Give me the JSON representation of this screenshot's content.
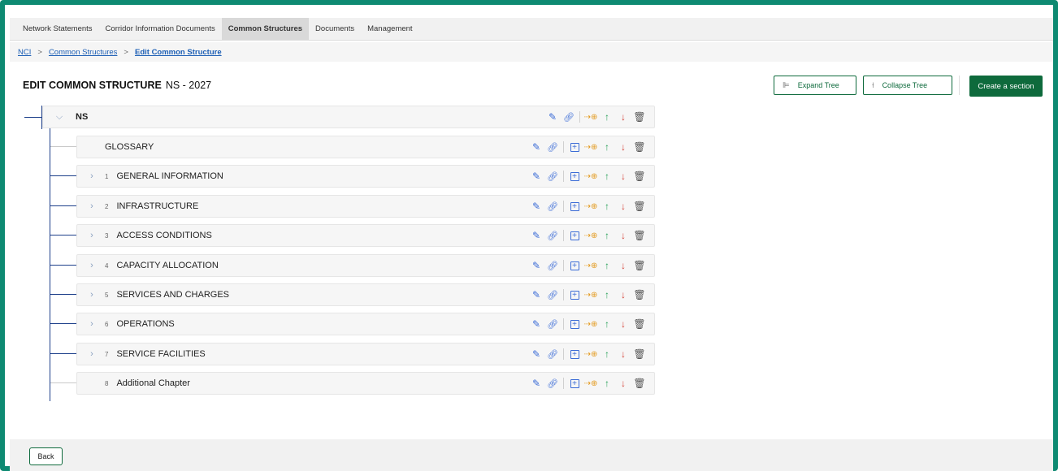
{
  "nav": {
    "tabs": [
      {
        "label": "Network Statements",
        "active": false
      },
      {
        "label": "Corridor Information Documents",
        "active": false
      },
      {
        "label": "Common Structures",
        "active": true
      },
      {
        "label": "Documents",
        "active": false
      },
      {
        "label": "Management",
        "active": false
      }
    ]
  },
  "breadcrumb": {
    "items": [
      "NCI",
      "Common Structures",
      "Edit Common Structure"
    ],
    "separator": ">"
  },
  "header": {
    "title": "EDIT COMMON STRUCTURE",
    "subtitle": "NS - 2027",
    "expand_label": "Expand Tree",
    "collapse_label": "Collapse Tree",
    "create_label": "Create a section"
  },
  "tree": {
    "root": {
      "label": "NS",
      "expanded": true
    },
    "children": [
      {
        "number": "",
        "label": "GLOSSARY",
        "has_children": false
      },
      {
        "number": "1",
        "label": "GENERAL INFORMATION",
        "has_children": true
      },
      {
        "number": "2",
        "label": "INFRASTRUCTURE",
        "has_children": true
      },
      {
        "number": "3",
        "label": "ACCESS CONDITIONS",
        "has_children": true
      },
      {
        "number": "4",
        "label": "CAPACITY ALLOCATION",
        "has_children": true
      },
      {
        "number": "5",
        "label": "SERVICES AND CHARGES",
        "has_children": true
      },
      {
        "number": "6",
        "label": "OPERATIONS",
        "has_children": true
      },
      {
        "number": "7",
        "label": "SERVICE FACILITIES",
        "has_children": true
      },
      {
        "number": "8",
        "label": "Additional Chapter",
        "has_children": false
      }
    ]
  },
  "footer": {
    "back_label": "Back"
  },
  "colors": {
    "frame": "#0e8a72",
    "primary": "#0e6a3c",
    "link": "#1d5fb5",
    "tree_line": "#1d3f8a",
    "up_arrow": "#29a15a",
    "down_arrow": "#d6453a",
    "move_icon": "#e39a1e"
  }
}
